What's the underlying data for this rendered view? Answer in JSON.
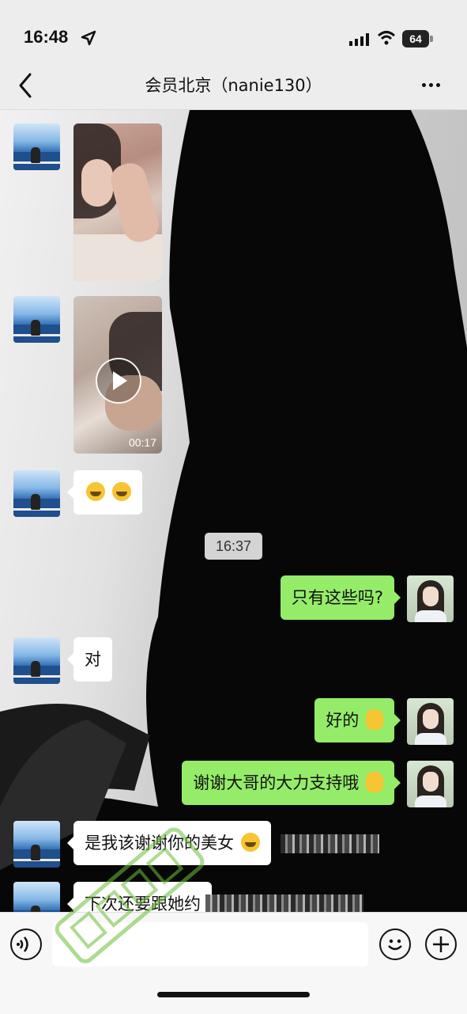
{
  "status_bar": {
    "time": "16:48",
    "battery": "64",
    "icons": [
      "location-arrow-icon",
      "signal-icon",
      "wifi-icon",
      "battery-icon"
    ]
  },
  "header": {
    "title": "会员北京（nanie130）",
    "back_icon": "chevron-left-icon",
    "more_icon": "more-dots-icon"
  },
  "messages": [
    {
      "sender": "contact",
      "type": "image"
    },
    {
      "sender": "contact",
      "type": "video",
      "duration": "00:17"
    },
    {
      "sender": "contact",
      "type": "emoji",
      "icon": "laughing-emoji-icon"
    },
    {
      "type": "timestamp",
      "text": "16:37"
    },
    {
      "sender": "me",
      "type": "text",
      "text": "只有这些吗?"
    },
    {
      "sender": "contact",
      "type": "text",
      "text": "对"
    },
    {
      "sender": "me",
      "type": "text",
      "text": "好的",
      "icon": "ok-hand-emoji-icon"
    },
    {
      "sender": "me",
      "type": "text",
      "text": "谢谢大哥的大力支持哦",
      "icon": "victory-hand-emoji-icon"
    },
    {
      "sender": "contact",
      "type": "text",
      "text": "是我该谢谢你的美女",
      "icon": "laughing-emoji-icon"
    },
    {
      "sender": "contact",
      "type": "text",
      "text": "下次还要跟她约"
    }
  ],
  "input_bar": {
    "placeholder": "",
    "voice_icon": "voice-icon",
    "emoji_icon": "emoji-smile-icon",
    "plus_icon": "plus-circle-icon"
  },
  "colors": {
    "my_bubble": "#95ec69",
    "their_bubble": "#ffffff",
    "background": "#ededed"
  }
}
